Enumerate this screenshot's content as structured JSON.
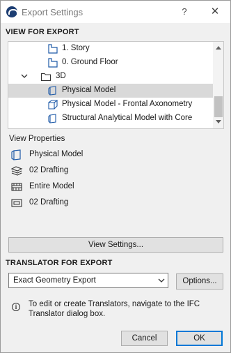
{
  "window": {
    "title": "Export Settings",
    "help_glyph": "?",
    "close_glyph": "✕"
  },
  "view_section": {
    "title": "VIEW FOR EXPORT",
    "tree": [
      {
        "label": "1. Story",
        "icon": "story-icon",
        "selected": false
      },
      {
        "label": "0. Ground Floor",
        "icon": "story-icon",
        "selected": false
      },
      {
        "label": "3D",
        "icon": "folder-icon",
        "expanded": true,
        "selected": false
      },
      {
        "label": "Physical Model",
        "icon": "3d-view-icon",
        "selected": true
      },
      {
        "label": "Physical Model - Frontal Axonometry",
        "icon": "axonometry-icon",
        "selected": false
      },
      {
        "label": "Structural Analytical Model with Core",
        "icon": "3d-view-icon",
        "selected": false
      }
    ]
  },
  "view_properties": {
    "title": "View Properties",
    "rows": [
      {
        "label": "Physical Model",
        "icon": "3d-view-icon"
      },
      {
        "label": "02 Drafting",
        "icon": "layers-icon"
      },
      {
        "label": "Entire Model",
        "icon": "model-filter-icon"
      },
      {
        "label": "02 Drafting",
        "icon": "pen-set-icon"
      }
    ]
  },
  "view_settings_button": "View Settings...",
  "translator_section": {
    "title": "TRANSLATOR FOR EXPORT",
    "selected": "Exact Geometry Export",
    "options_button": "Options...",
    "info_glyph": "i",
    "info_text": "To edit or create Translators, navigate to the IFC Translator dialog box."
  },
  "footer": {
    "cancel_label": "Cancel",
    "ok_label": "OK"
  },
  "colors": {
    "selection": "#d9d9d9",
    "default_button_border": "#0078d7",
    "icon_blue": "#1e5aa8"
  }
}
